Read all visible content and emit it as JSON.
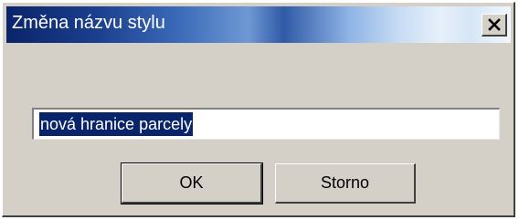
{
  "dialog": {
    "title": "Změna názvu stylu",
    "input_value": "nová hranice parcely",
    "ok_label": "OK",
    "cancel_label": "Storno"
  },
  "colors": {
    "titlebar_start": "#0a246a",
    "window_face": "#d4d0c8",
    "selection": "#0a246a"
  },
  "icons": {
    "close": "close-icon"
  }
}
